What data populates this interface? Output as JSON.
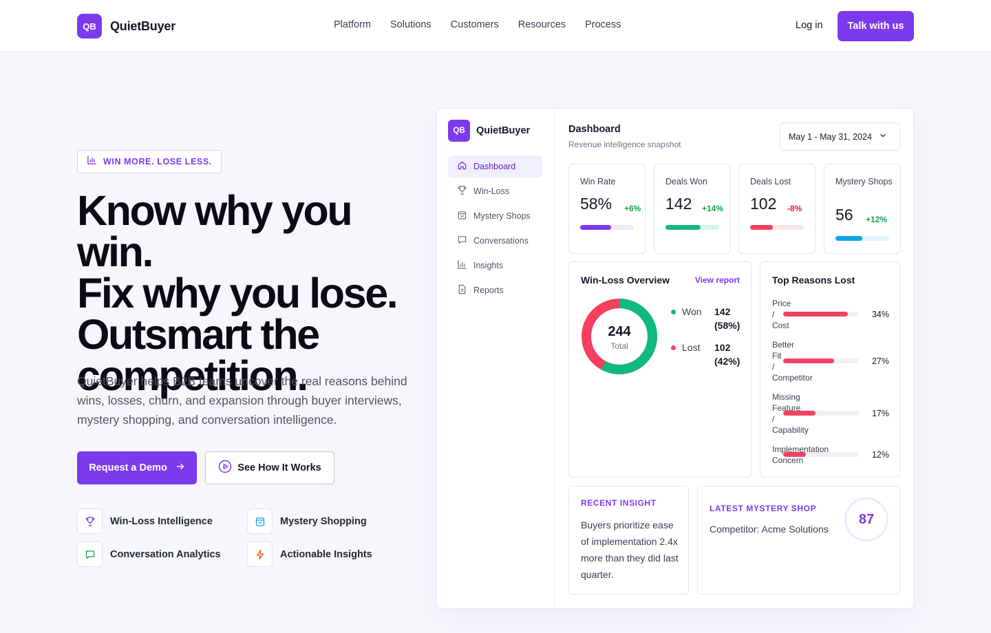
{
  "brand": {
    "mark": "QB",
    "name": "QuietBuyer"
  },
  "nav": {
    "items": [
      "Platform",
      "Solutions",
      "Customers",
      "Resources",
      "Process"
    ]
  },
  "header": {
    "login": "Log in",
    "cta": "Talk with us"
  },
  "hero": {
    "badge": "WIN MORE. LOSE LESS.",
    "headline": [
      "Know why you win.",
      "Fix why you lose.",
      "Outsmart the",
      "competition."
    ],
    "subtext": "QuietBuyer helps B2B teams uncover the real reasons behind wins, losses, churn, and expansion through buyer interviews, mystery shopping, and conversation intelligence.",
    "primary_button": "Request a Demo",
    "secondary_button": "See How It Works",
    "features": [
      {
        "label": "Win-Loss Intelligence",
        "icon": "trophy-icon",
        "color": "#7c3aed"
      },
      {
        "label": "Mystery Shopping",
        "icon": "shopping-bag-icon",
        "color": "#0ea5e9"
      },
      {
        "label": "Conversation Analytics",
        "icon": "chat-icon",
        "color": "#16a34a"
      },
      {
        "label": "Actionable Insights",
        "icon": "lightning-icon",
        "color": "#ea580c"
      }
    ]
  },
  "dashboard": {
    "brand": {
      "mark": "QB",
      "name": "QuietBuyer"
    },
    "sidebar": [
      {
        "label": "Dashboard",
        "icon": "home-icon",
        "active": true
      },
      {
        "label": "Win-Loss",
        "icon": "trophy-icon"
      },
      {
        "label": "Mystery Shops",
        "icon": "shopping-bag-icon"
      },
      {
        "label": "Conversations",
        "icon": "chat-icon"
      },
      {
        "label": "Insights",
        "icon": "bar-chart-icon"
      },
      {
        "label": "Reports",
        "icon": "document-icon"
      }
    ],
    "title": "Dashboard",
    "subtitle": "Revenue intelligence snapshot",
    "date_range": "May 1 - May 31, 2024",
    "kpis": [
      {
        "label": "Win Rate",
        "value": "58%",
        "delta": "+6%",
        "delta_color": "#16a34a",
        "bar_color": "#7c3aed",
        "track_color": "#ede9fe",
        "fill": 0.58
      },
      {
        "label": "Deals Won",
        "value": "142",
        "delta": "+14%",
        "delta_color": "#16a34a",
        "bar_color": "#10b981",
        "track_color": "#d1fae5",
        "fill": 0.66
      },
      {
        "label": "Deals Lost",
        "value": "102",
        "delta": "-8%",
        "delta_color": "#e11d48",
        "bar_color": "#f43f5e",
        "track_color": "#ffe4e6",
        "fill": 0.42
      },
      {
        "label": "Mystery Shops",
        "value": "56",
        "delta": "+12%",
        "delta_color": "#16a34a",
        "bar_color": "#0ea5e9",
        "track_color": "#e0f2fe",
        "fill": 0.5
      }
    ],
    "win_loss": {
      "title": "Win-Loss Overview",
      "view_report": "View report",
      "total": "244",
      "total_label": "Total",
      "won": {
        "label": "Won",
        "value": "142",
        "pct": "(58%)",
        "share": 0.58,
        "color": "#10b981"
      },
      "lost": {
        "label": "Lost",
        "value": "102",
        "pct": "(42%)",
        "share": 0.42,
        "color": "#f43f5e"
      }
    },
    "reasons": {
      "title": "Top Reasons Lost",
      "items": [
        {
          "label": "Price / Cost",
          "pct": "34%",
          "share": 0.34
        },
        {
          "label": "Better Fit / Competitor",
          "pct": "27%",
          "share": 0.27
        },
        {
          "label": "Missing Feature / Capability",
          "pct": "17%",
          "share": 0.17
        },
        {
          "label": "Implementation Concern",
          "pct": "12%",
          "share": 0.12
        }
      ]
    },
    "insight": {
      "kicker": "RECENT INSIGHT",
      "text": "Buyers prioritize ease of implementation 2.4x more than they did last quarter."
    },
    "mystery": {
      "kicker": "LATEST MYSTERY SHOP",
      "text": "Competitor: Acme Solutions",
      "score": "87"
    }
  }
}
